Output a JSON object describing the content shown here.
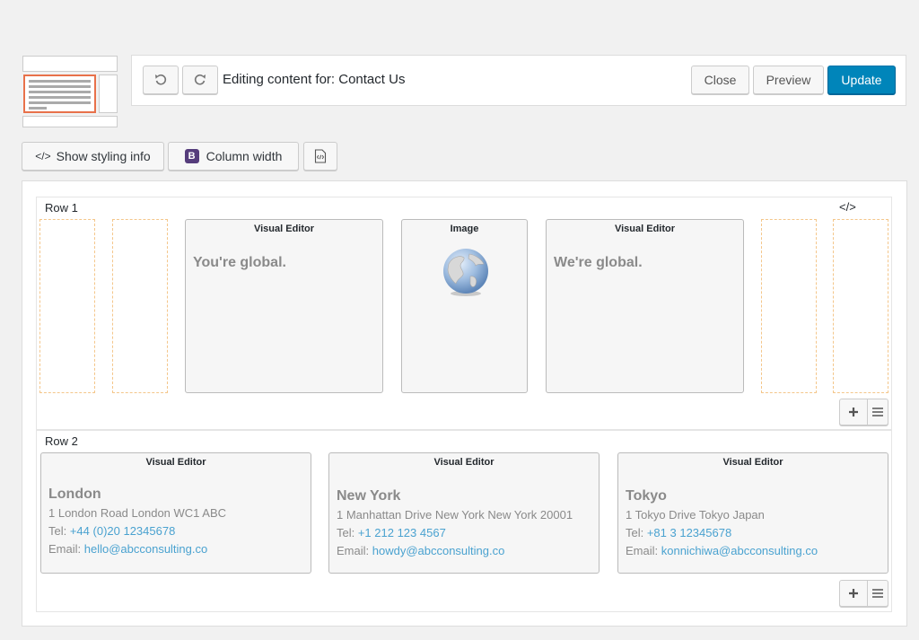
{
  "topbar": {
    "title": "Editing content for: Contact Us",
    "close_label": "Close",
    "preview_label": "Preview",
    "update_label": "Update",
    "undo_icon": "undo-icon",
    "redo_icon": "redo-icon"
  },
  "toolbar": {
    "styling_label": "Show styling info",
    "column_label": "Column width",
    "bootstrap_badge": "B"
  },
  "rows": [
    {
      "label": "Row 1",
      "code_glyph": "</>",
      "widgets": [
        {
          "title": "Visual Editor",
          "text": "You're global."
        },
        {
          "title": "Image"
        },
        {
          "title": "Visual Editor",
          "text": "We're global."
        }
      ]
    },
    {
      "label": "Row 2",
      "widgets": [
        {
          "title": "Visual Editor",
          "city": "London",
          "address": "1 London Road London WC1 ABC",
          "tel_label": "Tel: ",
          "tel": "+44 (0)20 12345678",
          "email_label": "Email: ",
          "email": "hello@abcconsulting.co"
        },
        {
          "title": "Visual Editor",
          "city": "New York",
          "address": "1 Manhattan Drive New York New York 20001",
          "tel_label": "Tel: ",
          "tel": "+1 212 123 4567",
          "email_label": "Email: ",
          "email": "howdy@abcconsulting.co"
        },
        {
          "title": "Visual Editor",
          "city": "Tokyo",
          "address": "1 Tokyo Drive Tokyo Japan",
          "tel_label": "Tel: ",
          "tel": "+81 3 12345678",
          "email_label": "Email: ",
          "email": "konnichiwa@abcconsulting.co"
        }
      ]
    }
  ],
  "colors": {
    "accent": "#0085ba",
    "selection": "#e8714a",
    "placeholder_border": "#f4c68a",
    "link": "#4aa2d0"
  }
}
